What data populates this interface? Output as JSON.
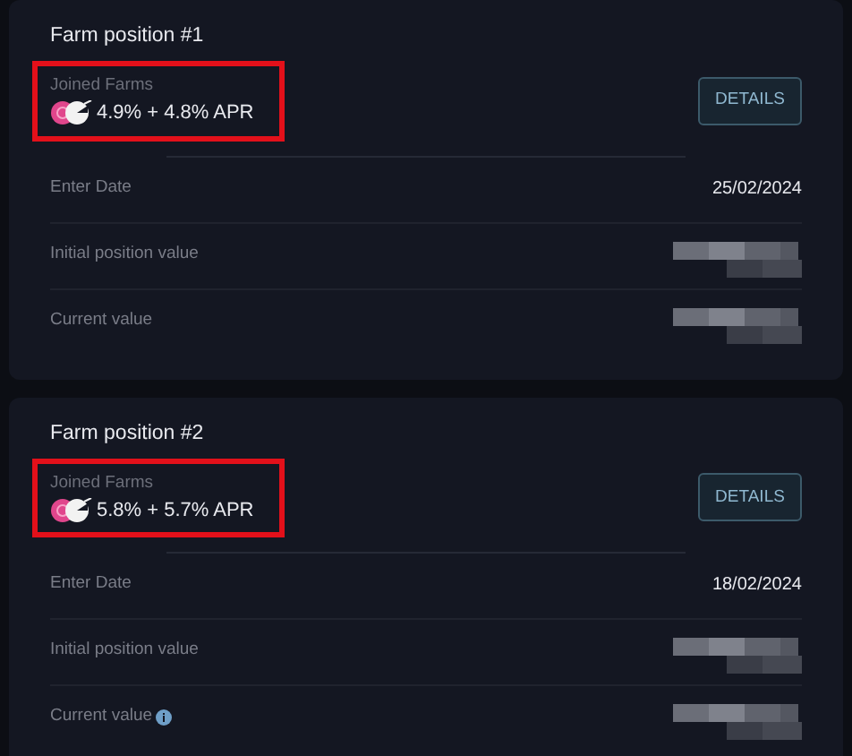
{
  "positions": [
    {
      "title": "Farm position #1",
      "joined_label": "Joined Farms",
      "apr": "4.9% + 4.8% APR",
      "highlighted": true,
      "button": "DETAILS",
      "rows": [
        {
          "label": "Enter Date",
          "kind": "text",
          "value": "25/02/2024",
          "info": false
        },
        {
          "label": "Initial position value",
          "kind": "redacted",
          "info": false
        },
        {
          "label": "Current value",
          "kind": "redacted",
          "info": false
        }
      ]
    },
    {
      "title": "Farm position #2",
      "joined_label": "Joined Farms",
      "apr": "5.8% + 5.7% APR",
      "highlighted": true,
      "button": "DETAILS",
      "rows": [
        {
          "label": "Enter Date",
          "kind": "text",
          "value": "18/02/2024",
          "info": false
        },
        {
          "label": "Initial position value",
          "kind": "redacted",
          "info": false
        },
        {
          "label": "Current value",
          "kind": "redacted",
          "info": true
        }
      ]
    }
  ]
}
